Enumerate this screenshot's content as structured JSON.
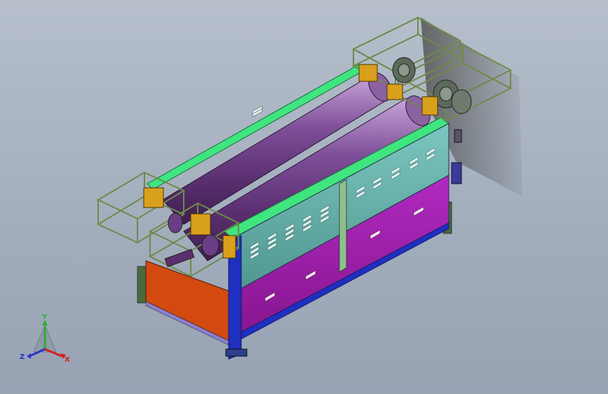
{
  "viewport": {
    "background_top": "#b6bfcb",
    "background_bottom": "#97a2b3"
  },
  "model": {
    "type": "3D CAD assembly - twin roller machine",
    "colors": {
      "frame_blue": "#1f2fbf",
      "panel_teal": "#5fa8a4",
      "panel_magenta": "#a21fb0",
      "end_red": "#d24a10",
      "rail_green": "#3fe57f",
      "roller_purple": "#6b3d86",
      "guard_olive": "#6f8a4a",
      "bracket_gold": "#d9a01c"
    }
  },
  "triad": {
    "x_label": "X",
    "y_label": "Y",
    "z_label": "Z",
    "x_color": "#d81e1e",
    "y_color": "#2fae2f",
    "z_color": "#2a32c8"
  }
}
